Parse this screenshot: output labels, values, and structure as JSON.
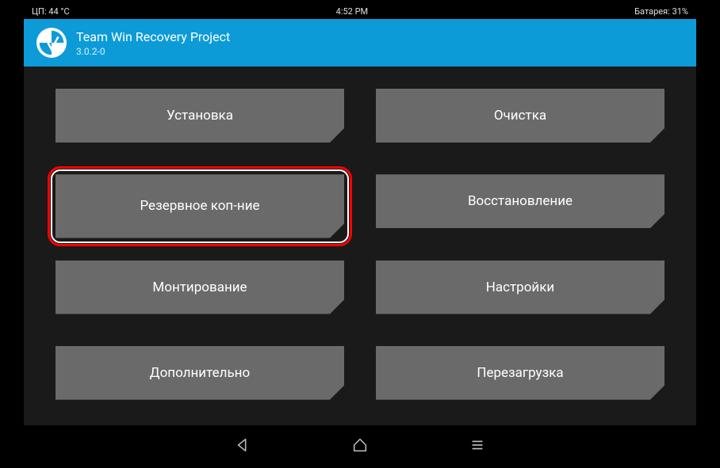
{
  "status": {
    "cpu_temp": "ЦП: 44 °C",
    "time": "4:52 PM",
    "battery": "Батарея: 31%"
  },
  "header": {
    "title": "Team Win Recovery Project",
    "version": "3.0.2-0"
  },
  "menu": {
    "install": "Установка",
    "wipe": "Очистка",
    "backup": "Резервное коп-ние",
    "restore": "Восстановление",
    "mount": "Монтирование",
    "settings": "Настройки",
    "advanced": "Дополнительно",
    "reboot": "Перезагрузка"
  },
  "colors": {
    "accent": "#0d9bd8",
    "button_bg": "#6a6a6a",
    "highlight": "#ff0000"
  }
}
